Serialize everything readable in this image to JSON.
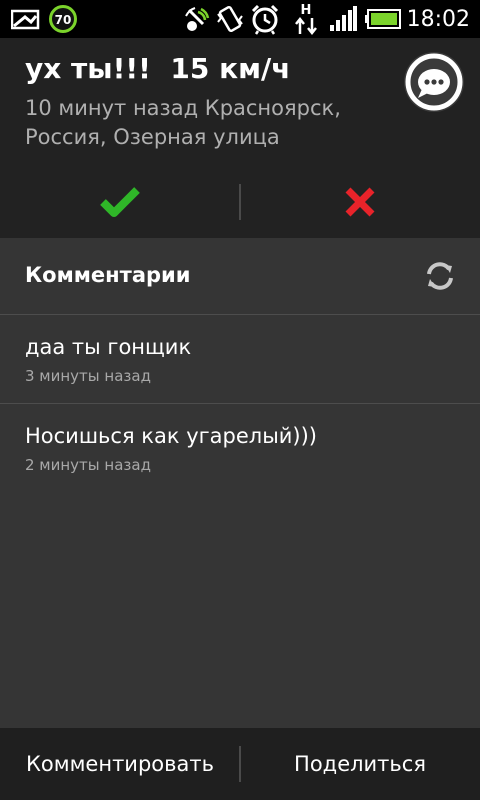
{
  "status_bar": {
    "battery_level_badge": "70",
    "network_type": "H",
    "time": "18:02"
  },
  "post": {
    "title": "ух ты!!!  15 км/ч",
    "subtitle": "10 минут назад Красноярск, Россия, Озерная улица"
  },
  "comments_section": {
    "title": "Комментарии",
    "items": [
      {
        "text": "даа ты гонщик",
        "time": "3 минуты назад"
      },
      {
        "text": "Носишься как угарелый)))",
        "time": "2 минуты назад"
      }
    ]
  },
  "bottom_bar": {
    "comment_label": "Комментировать",
    "share_label": "Поделиться"
  },
  "colors": {
    "accept": "#2fb628",
    "reject": "#e8232a"
  },
  "icons": [
    "image-icon",
    "battery-badge-icon",
    "gps-icon",
    "vibrate-icon",
    "alarm-icon",
    "data-transfer-icon",
    "signal-icon",
    "battery-icon",
    "chat-bubble-icon",
    "checkmark-icon",
    "cross-icon",
    "refresh-icon"
  ]
}
